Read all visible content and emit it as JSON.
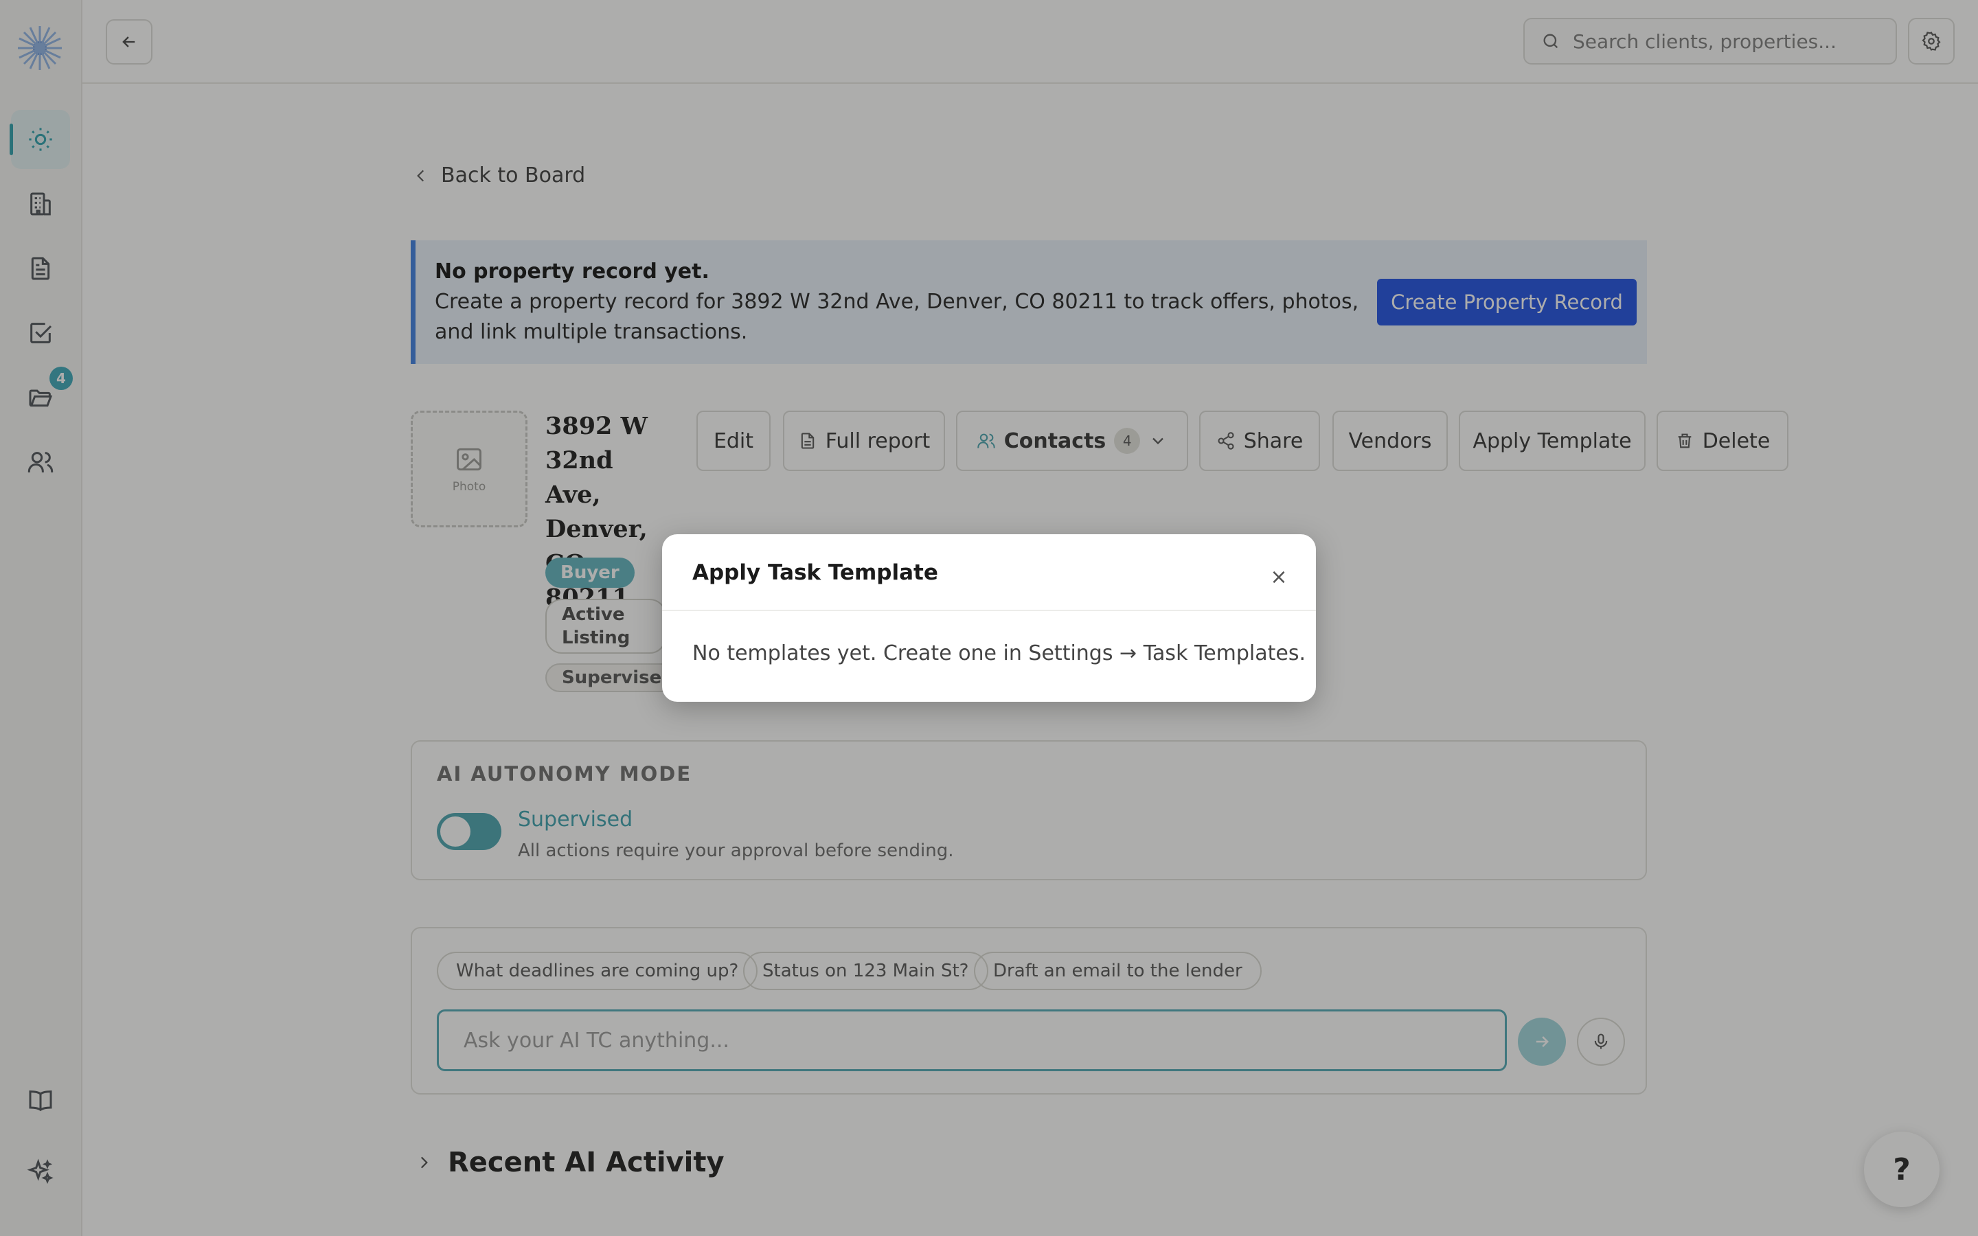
{
  "sidebar": {
    "badge_count": "4",
    "nav_icons": [
      "sun-icon",
      "building-icon",
      "document-icon",
      "checkbox-icon",
      "folder-icon",
      "users-icon"
    ],
    "bottom_icons": [
      "book-icon",
      "sparkles-icon"
    ]
  },
  "topbar": {
    "search_placeholder": "Search clients, properties..."
  },
  "main": {
    "back_link": "Back to Board",
    "banner": {
      "title": "No property record yet.",
      "text": "Create a property record for 3892 W 32nd Ave, Denver, CO 80211 to track offers, photos, and link multiple transactions.",
      "button": "Create Property Record"
    },
    "photo_label": "Photo",
    "property_title": "3892 W 32nd Ave, Denver, CO 80211",
    "tags": {
      "buyer": "Buyer",
      "active_listing": "Active Listing",
      "supervised": "Supervised"
    },
    "actions": {
      "edit": "Edit",
      "full_report": "Full report",
      "contacts": "Contacts",
      "contacts_count": "4",
      "share": "Share",
      "vendors": "Vendors",
      "apply_template": "Apply Template",
      "delete": "Delete"
    },
    "autonomy": {
      "label": "AI AUTONOMY MODE",
      "mode": "Supervised",
      "description": "All actions require your approval before sending."
    },
    "chat": {
      "chips": [
        "What deadlines are coming up?",
        "Status on 123 Main St?",
        "Draft an email to the lender"
      ],
      "placeholder": "Ask your AI TC anything..."
    },
    "recent_title": "Recent AI Activity"
  },
  "help_label": "?",
  "modal": {
    "title": "Apply Task Template",
    "close": "×",
    "body": "No templates yet. Create one in Settings → Task Templates."
  },
  "colors": {
    "accent": "#2ca0ad",
    "primary_button": "#1e50e3",
    "banner_bg": "#e9f1fb",
    "banner_border": "#3c7ee3"
  }
}
